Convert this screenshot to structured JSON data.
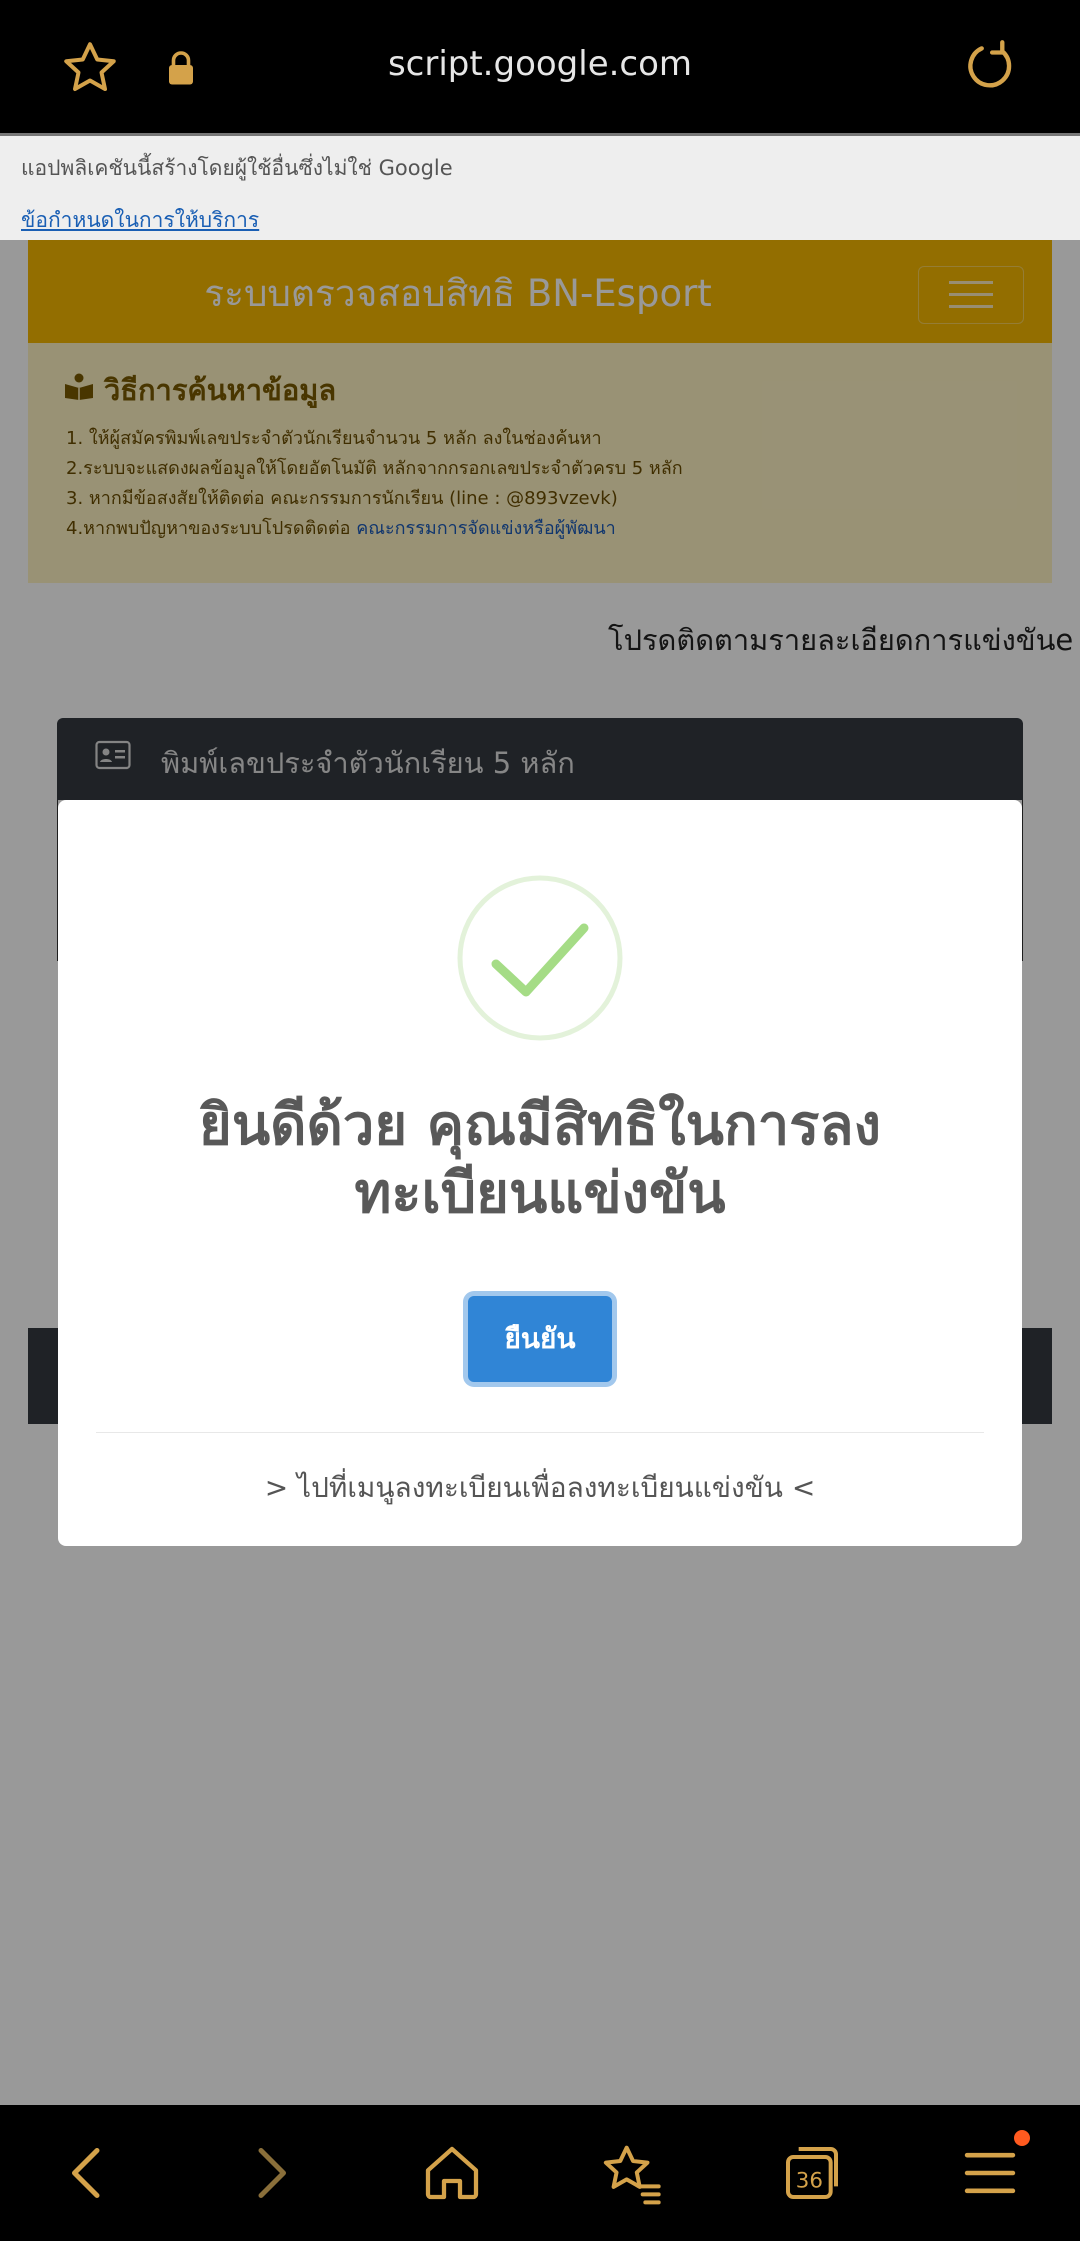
{
  "browser": {
    "url": "script.google.com",
    "tab_count": "36"
  },
  "banner": {
    "note": "แอปพลิเคชันนี้สร้างโดยผู้ใช้อื่นซึ่งไม่ใช่ Google",
    "terms_link": "ข้อกำหนดในการให้บริการ"
  },
  "page": {
    "title": "ระบบตรวจสอบสิทธิ BN-Esport",
    "howto": {
      "heading": "วิธีการค้นหาข้อมูล",
      "line1": "1. ให้ผู้สมัครพิมพ์เลขประจำตัวนักเรียนจำนวน 5 หลัก ลงในช่องค้นหา",
      "line2": "2.ระบบจะแสดงผลข้อมูลให้โดยอัตโนมัติ หลักจากกรอกเลขประจำตัวครบ 5 หลัก",
      "line3": "3. หากมีข้อสงสัยให้ติดต่อ คณะกรรมการนักเรียน (line : @893vzevk)",
      "line4_prefix": "4.หากพบปัญหาของระบบโปรดติดต่อ ",
      "line4_link": "คณะกรรมการจัดแข่งหรือผู้พัฒนา"
    },
    "marquee": "โปรดติดตามรายละเอียดการแข่งขันe",
    "search_label": "พิมพ์เลขประจำตัวนักเรียน 5 หลัก"
  },
  "modal": {
    "message_line1": "ยินดีด้วย คุณมีสิทธิในการลง",
    "message_line2": "ทะเบียนแข่งขัน",
    "confirm_label": "ยืนยัน",
    "footer": "> ไปที่เมนูลงทะเบียนเพื่อลงทะเบียนแข่งขัน <"
  },
  "colors": {
    "accent": "#d4a24a",
    "header": "#f5b800",
    "confirm": "#3085d6",
    "success": "#a5dc86"
  }
}
